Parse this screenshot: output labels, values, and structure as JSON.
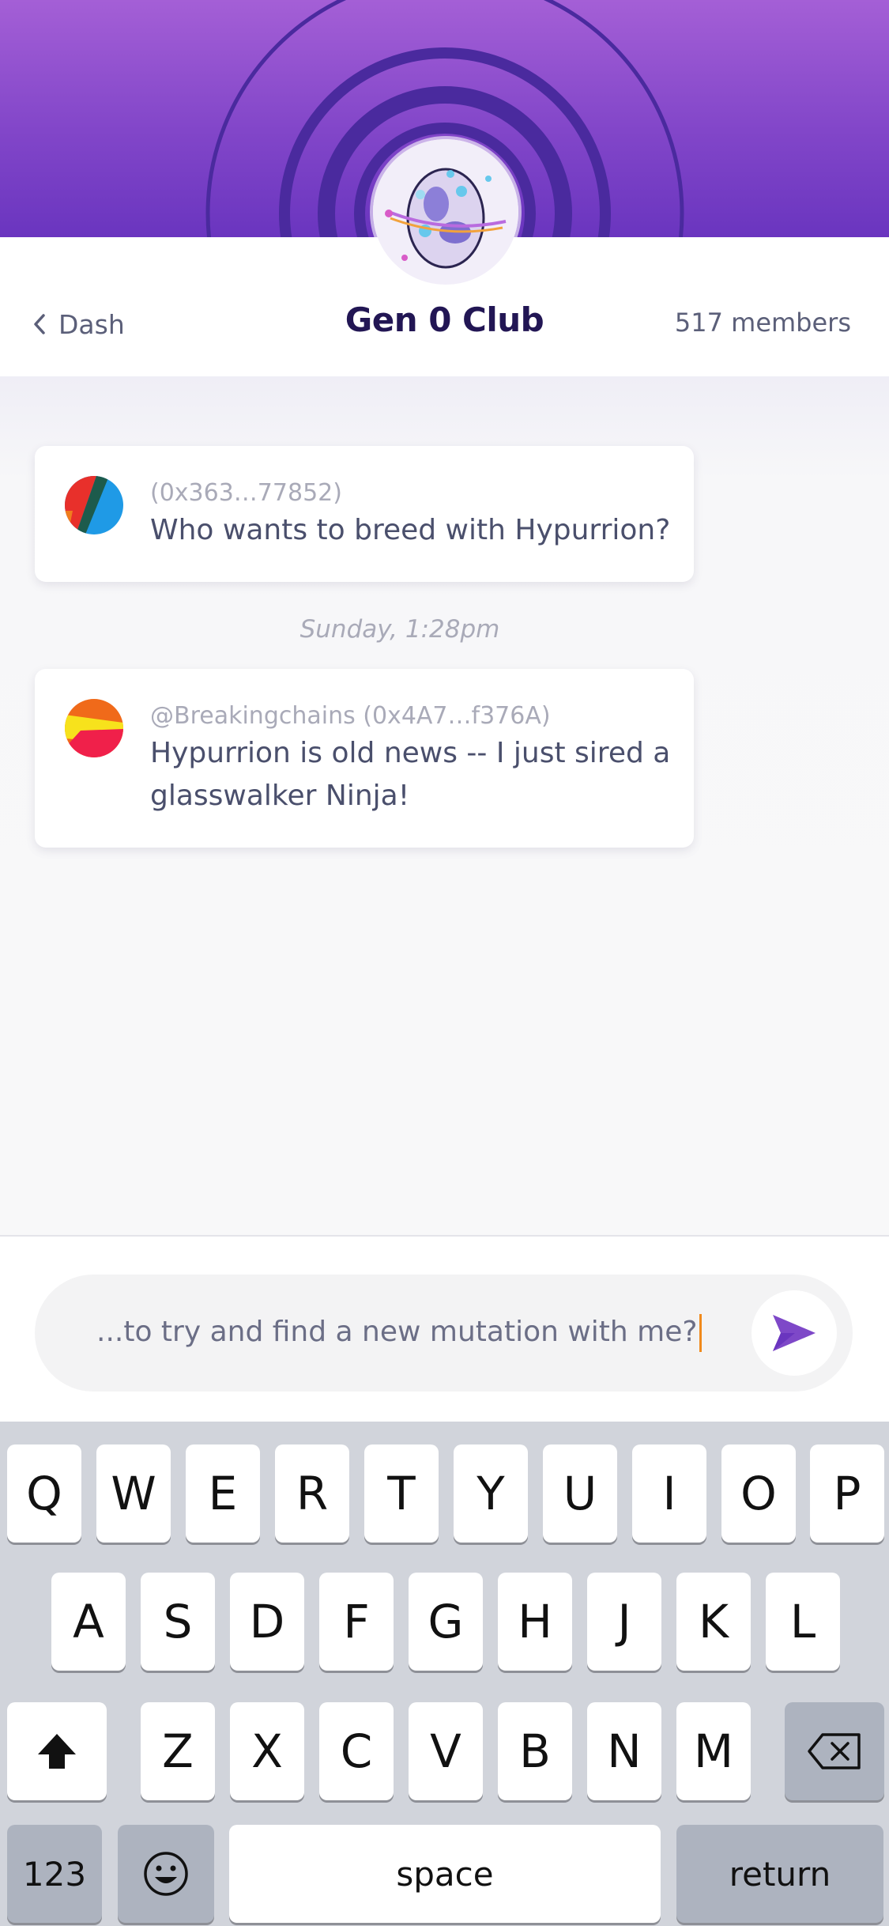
{
  "header": {
    "back_label": "Dash",
    "title": "Gen 0 Club",
    "members": "517 members"
  },
  "messages": [
    {
      "sender": "(0x363…77852)",
      "text": "Who wants to breed with Hypurrion?",
      "avatar_colors": [
        "#e8302b",
        "#1f9ae6",
        "#1d5b4c",
        "#f07d1e"
      ]
    },
    {
      "sender": "@Breakingchains (0x4A7…f376A)",
      "text": "Hypurrion is old news -- I just sired a glasswalker Ninja!",
      "avatar_colors": [
        "#f06a1a",
        "#f7e21c",
        "#f0204a"
      ]
    }
  ],
  "timestamp": "Sunday, 1:28pm",
  "composer": {
    "value": "...to try and find a new mutation with me?",
    "send_icon": "send-icon"
  },
  "keyboard": {
    "row1": [
      "Q",
      "W",
      "E",
      "R",
      "T",
      "Y",
      "U",
      "I",
      "O",
      "P"
    ],
    "row2": [
      "A",
      "S",
      "D",
      "F",
      "G",
      "H",
      "J",
      "K",
      "L"
    ],
    "row3": [
      "Z",
      "X",
      "C",
      "V",
      "B",
      "N",
      "M"
    ],
    "numbers": "123",
    "space": "space",
    "return": "return"
  },
  "colors": {
    "accent": "#7e48c8",
    "header_top": "#a45fd6",
    "title": "#221654"
  }
}
